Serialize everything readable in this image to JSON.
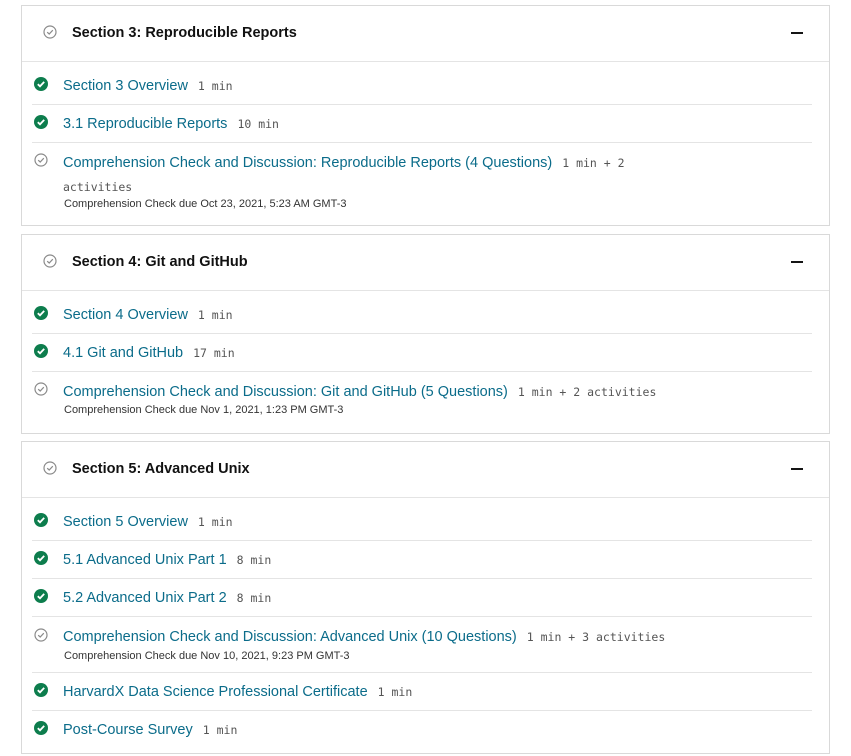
{
  "sections": [
    {
      "title": "Section 3: Reproducible Reports",
      "items": [
        {
          "label": "Section 3 Overview",
          "duration": "1 min",
          "completed": true
        },
        {
          "label": "3.1 Reproducible Reports",
          "duration": "10 min",
          "completed": true
        },
        {
          "label": "Comprehension Check and Discussion: Reproducible Reports (4 Questions)",
          "duration": "1 min + 2",
          "duration_cont": "activities",
          "due": "Comprehension Check due Oct 23, 2021, 5:23 AM GMT-3",
          "completed": false
        }
      ]
    },
    {
      "title": "Section 4: Git and GitHub",
      "items": [
        {
          "label": "Section 4 Overview",
          "duration": "1 min",
          "completed": true
        },
        {
          "label": "4.1 Git and GitHub",
          "duration": "17 min",
          "completed": true
        },
        {
          "label": "Comprehension Check and Discussion: Git and GitHub (5 Questions)",
          "duration": "1 min + 2 activities",
          "due": "Comprehension Check due Nov 1, 2021, 1:23 PM GMT-3",
          "completed": false
        }
      ]
    },
    {
      "title": "Section 5: Advanced Unix",
      "items": [
        {
          "label": "Section 5 Overview",
          "duration": "1 min",
          "completed": true
        },
        {
          "label": "5.1 Advanced Unix Part 1",
          "duration": "8 min",
          "completed": true
        },
        {
          "label": "5.2 Advanced Unix Part 2",
          "duration": "8 min",
          "completed": true
        },
        {
          "label": "Comprehension Check and Discussion: Advanced Unix (10 Questions)",
          "duration": "1 min + 3 activities",
          "due": "Comprehension Check due Nov 10, 2021, 9:23 PM GMT-3",
          "completed": false
        },
        {
          "label": "HarvardX Data Science Professional Certificate",
          "duration": "1 min",
          "completed": true
        },
        {
          "label": "Post-Course Survey",
          "duration": "1 min",
          "completed": true
        }
      ]
    }
  ],
  "colors": {
    "link": "#0b6c8a",
    "complete": "#0d7d4d",
    "incomplete": "#8a8a8a"
  },
  "icons": {
    "complete": "check-circle-filled-icon",
    "incomplete": "check-circle-outline-icon",
    "collapse": "minus-icon"
  }
}
